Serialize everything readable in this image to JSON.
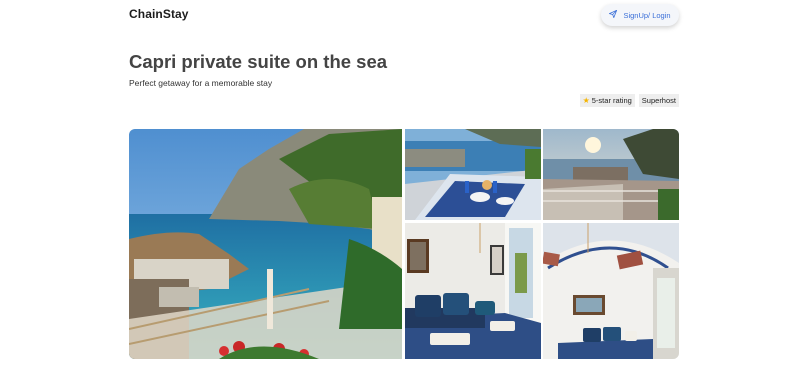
{
  "header": {
    "logo": "ChainStay",
    "signup_label": "SignUp/ Login"
  },
  "listing": {
    "title": "Capri private suite on the sea",
    "subtitle": "Perfect getaway for a memorable stay",
    "badges": {
      "rating": "5-star rating",
      "host": "Superhost"
    }
  },
  "icons": {
    "signup": "send-icon",
    "rating": "star-icon"
  },
  "colors": {
    "accent": "#3a6fd8",
    "star": "#f5b400"
  }
}
